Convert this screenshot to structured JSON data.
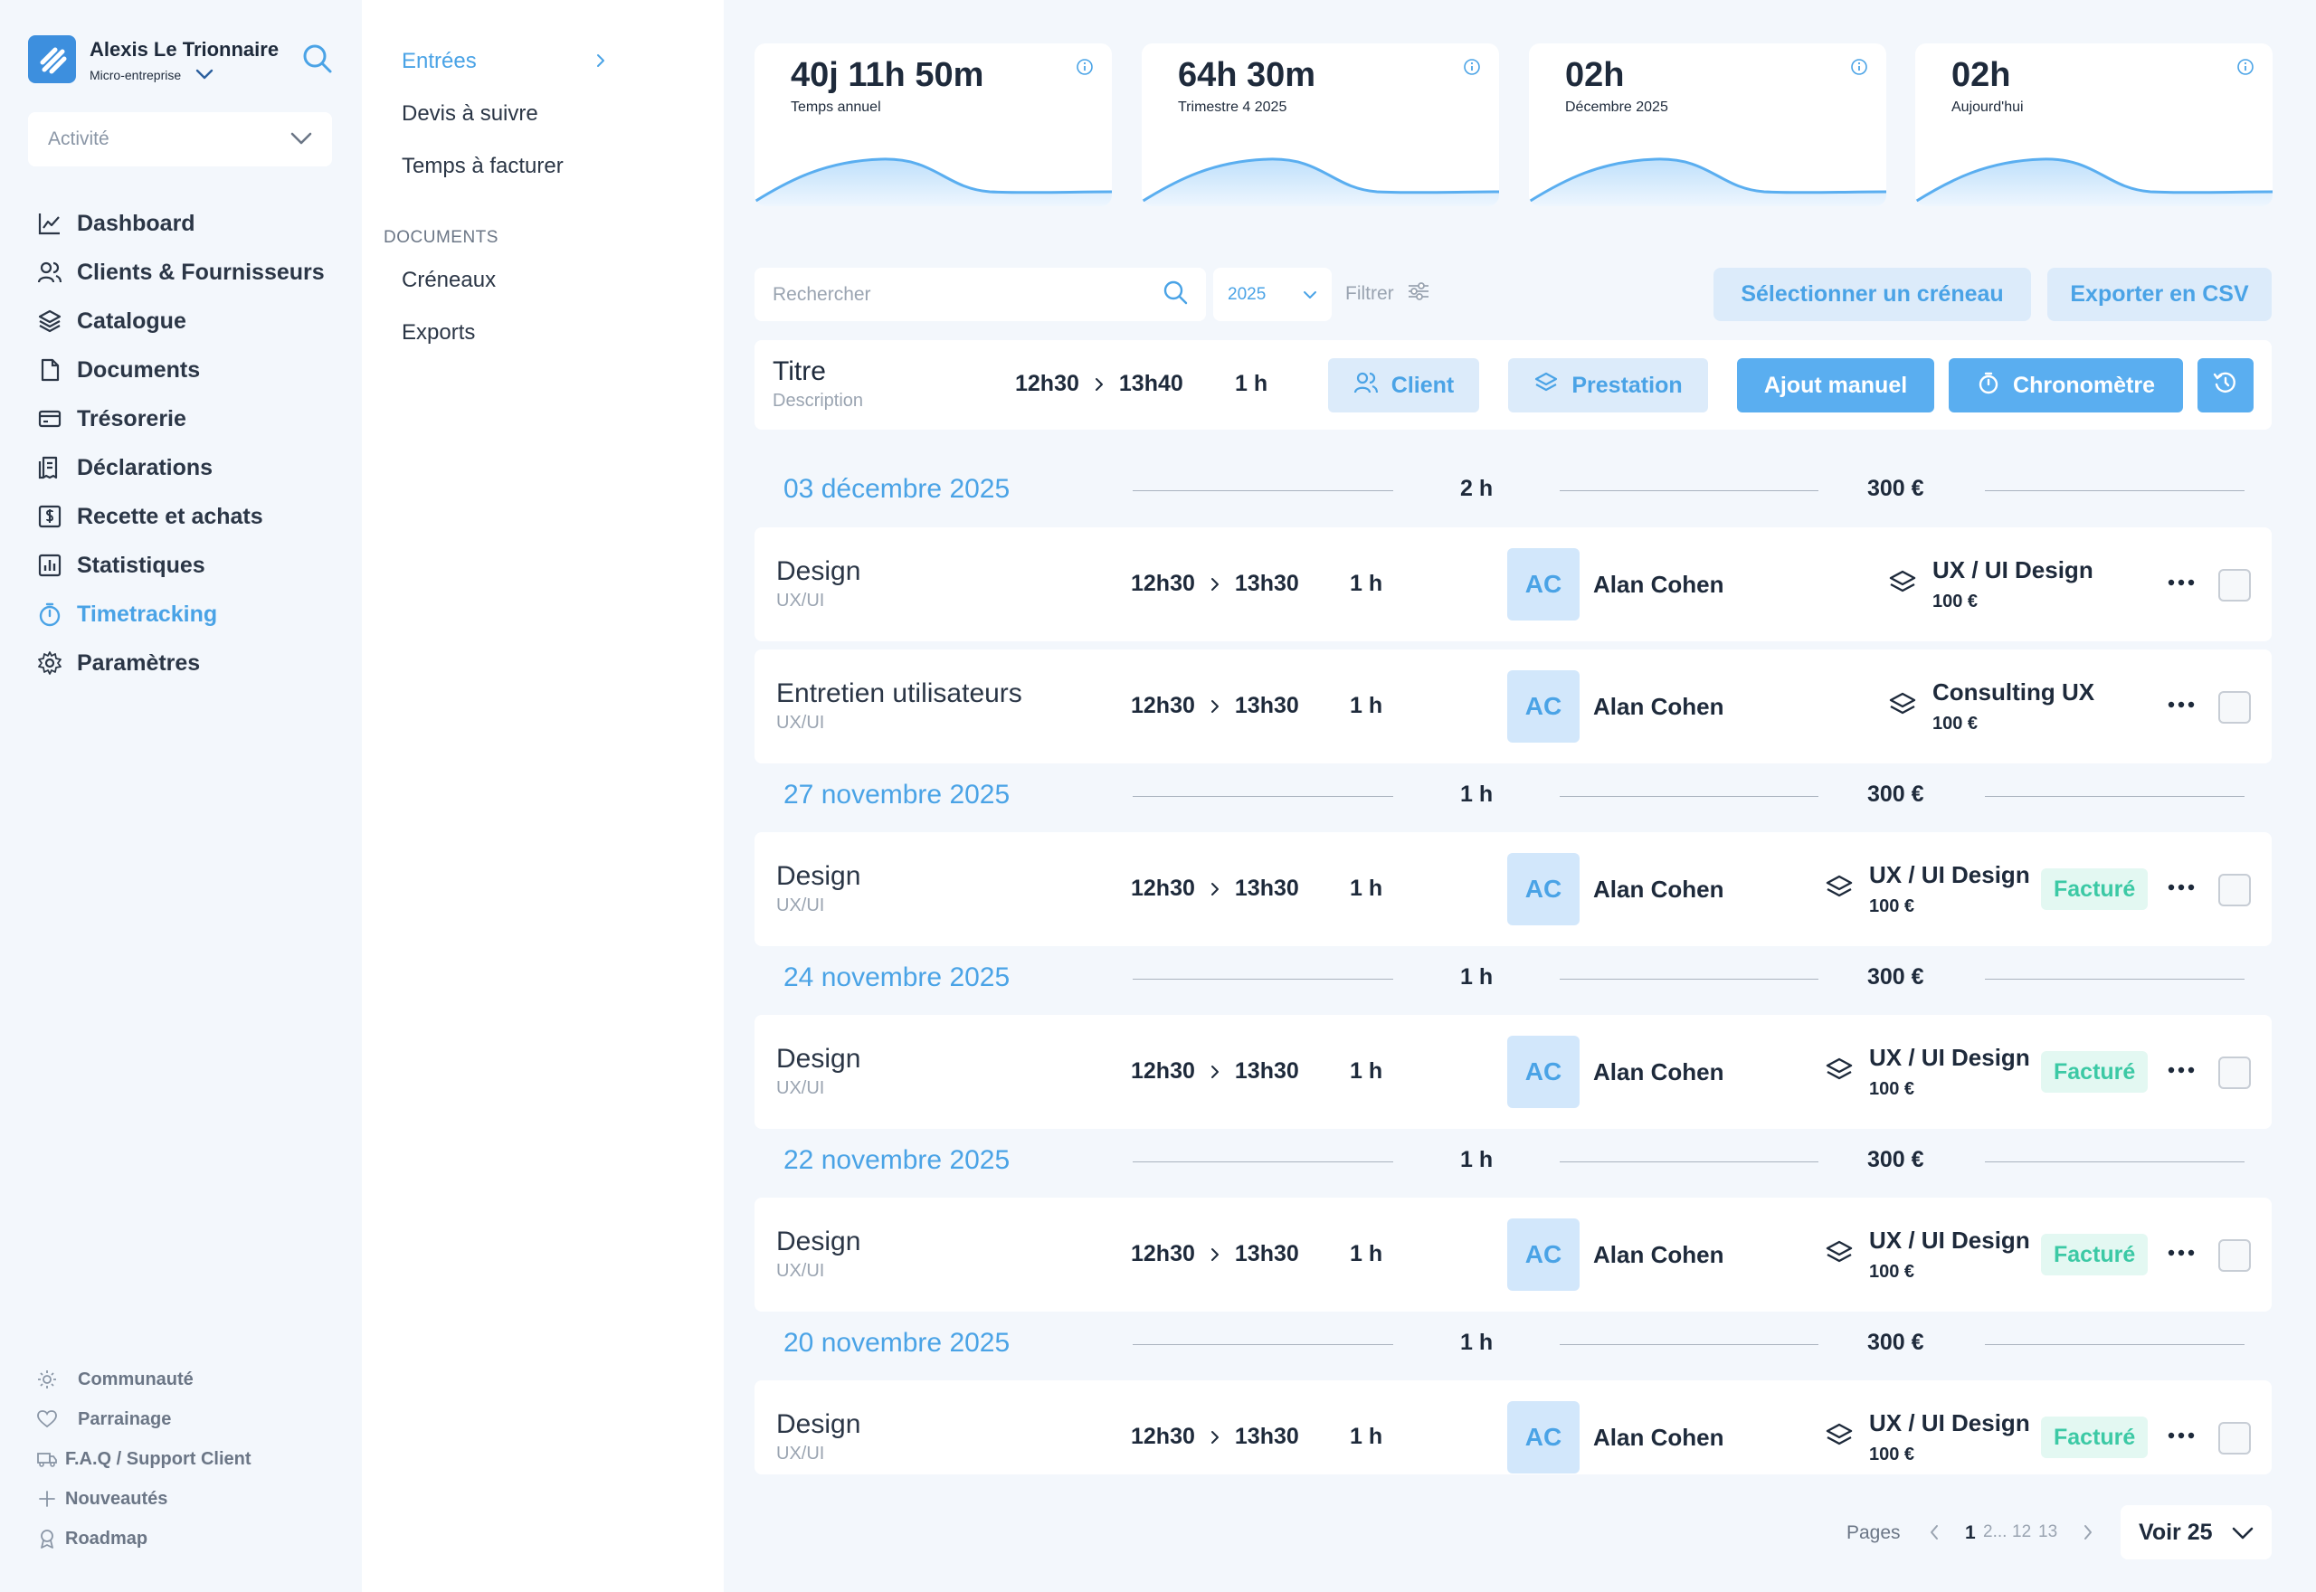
{
  "brand": {
    "name": "Alexis Le Trionnaire",
    "company_type": "Micro-entreprise"
  },
  "activity_select": {
    "value": "Activité"
  },
  "nav": [
    {
      "label": "Dashboard",
      "icon": "chart-line-icon"
    },
    {
      "label": "Clients & Fournisseurs",
      "icon": "users-icon"
    },
    {
      "label": "Catalogue",
      "icon": "layers-icon"
    },
    {
      "label": "Documents",
      "icon": "file-icon"
    },
    {
      "label": "Trésorerie",
      "icon": "credit-card-icon"
    },
    {
      "label": "Déclarations",
      "icon": "receipt-icon"
    },
    {
      "label": "Recette et achats",
      "icon": "cash-icon"
    },
    {
      "label": "Statistiques",
      "icon": "bar-chart-icon"
    },
    {
      "label": "Timetracking",
      "icon": "stopwatch-icon",
      "active": true
    },
    {
      "label": "Paramètres",
      "icon": "gear-icon"
    }
  ],
  "bottom_links": [
    {
      "label": "Communauté",
      "icon": "sun-icon"
    },
    {
      "label": "Parrainage",
      "icon": "heart-icon"
    },
    {
      "label": "F.A.Q / Support Client",
      "icon": "truck-icon"
    },
    {
      "label": "Nouveautés",
      "icon": "plus-icon"
    },
    {
      "label": "Roadmap",
      "icon": "award-icon"
    }
  ],
  "subnav": {
    "items": [
      {
        "label": "Entrées",
        "active": true
      },
      {
        "label": "Devis à suivre"
      },
      {
        "label": "Temps à facturer"
      }
    ],
    "documents_heading": "DOCUMENTS",
    "document_items": [
      {
        "label": "Créneaux"
      },
      {
        "label": "Exports"
      }
    ]
  },
  "stats": [
    {
      "value": "40j 11h 50m",
      "label": "Temps annuel"
    },
    {
      "value": "64h 30m",
      "label": "Trimestre 4 2025"
    },
    {
      "value": "02h",
      "label": "Décembre 2025"
    },
    {
      "value": "02h",
      "label": "Aujourd'hui"
    }
  ],
  "toolbar": {
    "search_placeholder": "Rechercher",
    "year": "2025",
    "filter_label": "Filtrer",
    "select_slot_label": "Sélectionner un créneau",
    "export_label": "Exporter en CSV"
  },
  "composer": {
    "title_placeholder": "Titre",
    "description_placeholder": "Description",
    "start": "12h30",
    "end": "13h40",
    "duration": "1 h",
    "client_label": "Client",
    "service_label": "Prestation",
    "manual_add_label": "Ajout manuel",
    "timer_label": "Chronomètre"
  },
  "groups": [
    {
      "date": "03 décembre 2025",
      "duration": "2 h",
      "amount": "300 €",
      "entries": [
        {
          "title": "Design",
          "subtitle": "UX/UI",
          "start": "12h30",
          "end": "13h30",
          "duration": "1 h",
          "client_initials": "AC",
          "client": "Alan Cohen",
          "service": "UX / UI Design",
          "price": "100 €",
          "status": ""
        },
        {
          "title": "Entretien utilisateurs",
          "subtitle": "UX/UI",
          "start": "12h30",
          "end": "13h30",
          "duration": "1 h",
          "client_initials": "AC",
          "client": "Alan Cohen",
          "service": "Consulting UX",
          "price": "100 €",
          "status": ""
        }
      ]
    },
    {
      "date": "27 novembre 2025",
      "duration": "1 h",
      "amount": "300 €",
      "entries": [
        {
          "title": "Design",
          "subtitle": "UX/UI",
          "start": "12h30",
          "end": "13h30",
          "duration": "1 h",
          "client_initials": "AC",
          "client": "Alan Cohen",
          "service": "UX / UI Design",
          "price": "100 €",
          "status": "Facturé"
        }
      ]
    },
    {
      "date": "24 novembre 2025",
      "duration": "1 h",
      "amount": "300 €",
      "entries": [
        {
          "title": "Design",
          "subtitle": "UX/UI",
          "start": "12h30",
          "end": "13h30",
          "duration": "1 h",
          "client_initials": "AC",
          "client": "Alan Cohen",
          "service": "UX / UI Design",
          "price": "100 €",
          "status": "Facturé"
        }
      ]
    },
    {
      "date": "22 novembre 2025",
      "duration": "1 h",
      "amount": "300 €",
      "entries": [
        {
          "title": "Design",
          "subtitle": "UX/UI",
          "start": "12h30",
          "end": "13h30",
          "duration": "1 h",
          "client_initials": "AC",
          "client": "Alan Cohen",
          "service": "UX / UI Design",
          "price": "100 €",
          "status": "Facturé"
        }
      ]
    },
    {
      "date": "20 novembre 2025",
      "duration": "1 h",
      "amount": "300 €",
      "entries": [
        {
          "title": "Design",
          "subtitle": "UX/UI",
          "start": "12h30",
          "end": "13h30",
          "duration": "1 h",
          "client_initials": "AC",
          "client": "Alan Cohen",
          "service": "UX / UI Design",
          "price": "100 €",
          "status": "Facturé"
        }
      ]
    }
  ],
  "pagination": {
    "label": "Pages",
    "current": "1",
    "pages": [
      "2...",
      "12",
      "13"
    ],
    "per_page": "Voir 25"
  },
  "colors": {
    "accent": "#4aa3e6",
    "accent_solid": "#5aaef0",
    "accent_soft": "#dcebfa",
    "status_billed": "#3cc9a5",
    "background": "#f3f7fc"
  }
}
